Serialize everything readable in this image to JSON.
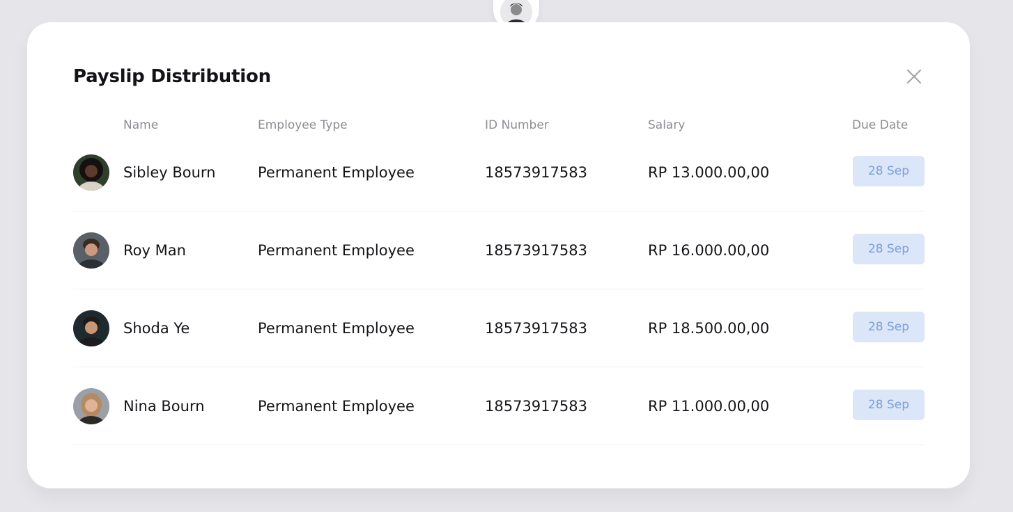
{
  "modal": {
    "title": "Payslip Distribution"
  },
  "columns": {
    "name": "Name",
    "employee_type": "Employee Type",
    "id_number": "ID Number",
    "salary": "Salary",
    "due_date": "Due Date"
  },
  "rows": [
    {
      "name": "Sibley Bourn",
      "type": "Permanent Employee",
      "id": "18573917583",
      "salary": "RP 13.000.00,00",
      "due": "28 Sep",
      "skin": "#5a3b2c",
      "hair": "#161110",
      "shirt": "#d9d2c6",
      "bg": "#2e3f2c"
    },
    {
      "name": "Roy Man",
      "type": "Permanent Employee",
      "id": "18573917583",
      "salary": "RP 16.000.00,00",
      "due": "28 Sep",
      "skin": "#c99a7f",
      "hair": "#3a2a20",
      "shirt": "#2b3036",
      "bg": "#5a6068"
    },
    {
      "name": "Shoda Ye",
      "type": "Permanent Employee",
      "id": "18573917583",
      "salary": "RP 18.500.00,00",
      "due": "28 Sep",
      "skin": "#c8977a",
      "hair": "#241a15",
      "shirt": "#1c1c1f",
      "bg": "#1f2a2e"
    },
    {
      "name": "Nina Bourn",
      "type": "Permanent Employee",
      "id": "18573917583",
      "salary": "RP 11.000.00,00",
      "due": "28 Sep",
      "skin": "#e0b397",
      "hair": "#b58a62",
      "shirt": "#2a2a2a",
      "bg": "#9aa0a6"
    }
  ]
}
